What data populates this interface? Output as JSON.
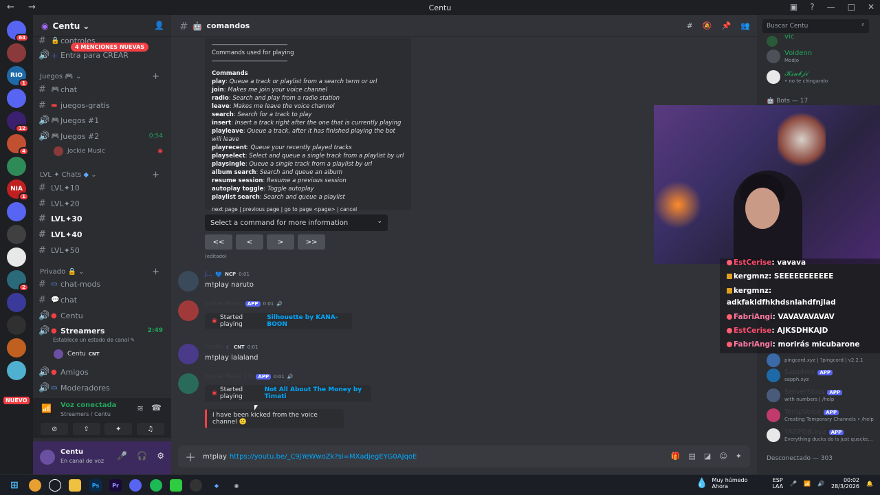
{
  "window": {
    "title": "Centu"
  },
  "servers": [
    {
      "label": "",
      "badge": "64",
      "color": "#5865f2"
    },
    {
      "label": "",
      "badge": "",
      "color": "#8a3a3a"
    },
    {
      "label": "RIO",
      "badge": "1",
      "color": "#1e6aa8"
    },
    {
      "label": "",
      "badge": "",
      "color": "#5865f2"
    },
    {
      "label": "",
      "badge": "12",
      "color": "#3b2070"
    },
    {
      "label": "",
      "badge": "4",
      "color": "#c05030"
    },
    {
      "label": "",
      "badge": "",
      "color": "#2e8b57"
    },
    {
      "label": "NIA",
      "badge": "1",
      "color": "#c02020"
    },
    {
      "label": "",
      "badge": "",
      "color": "#5865f2"
    },
    {
      "label": "",
      "badge": "",
      "color": "#404040"
    },
    {
      "label": "",
      "badge": "",
      "color": "#e8e8e8"
    },
    {
      "label": "",
      "badge": "2",
      "color": "#2a6a7a"
    },
    {
      "label": "",
      "badge": "",
      "color": "#3a3a9a"
    },
    {
      "label": "",
      "badge": "",
      "color": "#303030"
    },
    {
      "label": "",
      "badge": "",
      "color": "#c06020"
    },
    {
      "label": "",
      "badge": "",
      "color": "#50b0d0"
    }
  ],
  "rail_new": "NUEVO",
  "sidebar": {
    "server_name": "Centu",
    "mentions": "4 MENCIONES NUEVAS",
    "channels_top": [
      {
        "name": "controles",
        "type": "text"
      },
      {
        "name": "Entra para CREAR",
        "type": "voice"
      }
    ],
    "cat_juegos": "Juegos",
    "juegos": [
      {
        "name": "chat",
        "type": "text",
        "icon": "🎮"
      },
      {
        "name": "juegos-gratis",
        "type": "text",
        "icon": ""
      },
      {
        "name": "Juegos #1",
        "type": "voice",
        "time": ""
      },
      {
        "name": "Juegos #2",
        "type": "voice",
        "time": "0:54"
      }
    ],
    "voice_user": "Jockie Music",
    "cat_lvl": "LVL ✦ Chats",
    "lvl": [
      "LVL✦10",
      "LVL✦20",
      "LVL✦30",
      "LVL✦40",
      "LVL✦50"
    ],
    "cat_priv": "Privado",
    "priv": [
      {
        "name": "chat-mods",
        "type": "text"
      },
      {
        "name": "chat",
        "type": "text"
      },
      {
        "name": "Centu",
        "type": "voice"
      },
      {
        "name": "Streamers",
        "type": "voice",
        "time": "2:49"
      }
    ],
    "status_hint": "Establece un estado de canal",
    "streamer_user": "Centu",
    "streamer_tag": "CNT",
    "after": [
      {
        "name": "Amigos",
        "type": "voice"
      },
      {
        "name": "Moderadores",
        "type": "voice"
      }
    ],
    "voice_panel": {
      "title": "Voz conectada",
      "sub": "Streamers / Centu"
    },
    "user": {
      "name": "Centu",
      "status": "En canal de voz"
    }
  },
  "channel": {
    "name": "comandos"
  },
  "embed": {
    "sep": "-----------------------------------------------------",
    "subtitle": "Commands used for playing",
    "heading": "Commands",
    "commands": [
      {
        "cmd": "play",
        "desc": "Queue a track or playlist from a search term or url"
      },
      {
        "cmd": "join",
        "desc": "Makes me join your voice channel"
      },
      {
        "cmd": "radio",
        "desc": "Search and play from a radio station"
      },
      {
        "cmd": "leave",
        "desc": "Makes me leave the voice channel"
      },
      {
        "cmd": "search",
        "desc": "Search for a track to play"
      },
      {
        "cmd": "insert",
        "desc": "Insert a track right after the one that is currently playing"
      },
      {
        "cmd": "playleave",
        "desc": "Queue a track, after it has finished playing the bot will leave"
      },
      {
        "cmd": "playrecent",
        "desc": "Queue your recently played tracks"
      },
      {
        "cmd": "playselect",
        "desc": "Select and queue a single track from a playlist by url"
      },
      {
        "cmd": "playsingle",
        "desc": "Queue a single track from a playlist by url"
      },
      {
        "cmd": "album search",
        "desc": "Search and queue an album"
      },
      {
        "cmd": "resume session",
        "desc": "Resume a previous session"
      },
      {
        "cmd": "autoplay toggle",
        "desc": "Toggle autoplay"
      },
      {
        "cmd": "playlist search",
        "desc": "Search and queue a playlist"
      }
    ],
    "footer": "next page | previous page | go to page <page> | cancel"
  },
  "select_placeholder": "Select a command for more information",
  "nav_buttons": [
    "<<",
    "<",
    ">",
    ">>"
  ],
  "edited": "(editado)",
  "messages": [
    {
      "name": "j...",
      "tag": "NCP",
      "time": "0:01",
      "text": "m!play naruto"
    },
    {
      "name": "Jockie Music",
      "tag": "APP",
      "time": "0:01",
      "embed_prefix": "Started playing",
      "embed_link": "Silhouette by KANA-BOON"
    },
    {
      "name": "Centu",
      "tag": "CNT",
      "time": "0:01",
      "text": "m!play lalaland"
    },
    {
      "name": "Jockie Music (1)",
      "tag": "APP",
      "time": "0:01",
      "embed_prefix": "Started playing",
      "embed_link": "Not All About The Money by Timati"
    }
  ],
  "kick_text": "I have been kicked from the voice channel 🙁",
  "input": {
    "cmd": "m!play",
    "url": "https://youtu.be/_C9jYeWwoZk?si=MXadjegEYG0AJqoE"
  },
  "members": {
    "search_placeholder": "Buscar Centu",
    "top": [
      {
        "name": "vic",
        "status": "",
        "color": "#23a55a"
      },
      {
        "name": "Voidenn",
        "status": "Modjo",
        "color": "#23a55a"
      },
      {
        "name": "𝓚𝓼𝓾𝓫𝓳𝓲",
        "status": "• no te chingando",
        "color": "#23a55a"
      }
    ],
    "bots_header": "Bots — 17",
    "bots": [
      {
        "name": "",
        "status": "pingcord.xyz | ?pingcord | v2.2.1",
        "tag": ""
      },
      {
        "name": "Sapphire",
        "status": "sapph.xyz",
        "tag": "APP"
      },
      {
        "name": "ServerStats",
        "status": "with numbers | /help",
        "tag": "APP"
      },
      {
        "name": "TempVoice",
        "status": "Creating Temporary Channels • /help",
        "tag": "APP"
      },
      {
        "name": "YAGPDB.xyz",
        "status": "Everything ducks do is just quacke...",
        "tag": "APP"
      }
    ],
    "offline": "Desconectado — 303"
  },
  "stream_chat": [
    {
      "user": "EstCerise",
      "msg": ": vavava",
      "color": "#ff4d6d",
      "badge": "dot"
    },
    {
      "user": "kergmnz",
      "msg": ": SEEEEEEEEEEE",
      "color": "#ffffff",
      "badge": "sq"
    },
    {
      "user": "kergmnz",
      "msg": ":",
      "color": "#ffffff",
      "badge": "sq"
    },
    {
      "user": "",
      "msg": "adkfakldfhkhdsnlahdfnjlad",
      "color": "#ffffff",
      "badge": ""
    },
    {
      "user": "FabriAngi",
      "msg": ": VAVAVAVAVAV",
      "color": "#ff7aa0",
      "badge": "dot"
    },
    {
      "user": "EstCerise",
      "msg": ": AJKSDHKAJD",
      "color": "#ff4d6d",
      "badge": "dot"
    },
    {
      "user": "FabriAngi",
      "msg": ": morirás micubarone",
      "color": "#ff7aa0",
      "badge": "dot"
    }
  ],
  "taskbar": {
    "weather_title": "Muy húmedo",
    "weather_sub": "Ahora",
    "lang": "ESP",
    "lang2": "LAA",
    "time": "00:02",
    "date": "28/3/2026"
  }
}
